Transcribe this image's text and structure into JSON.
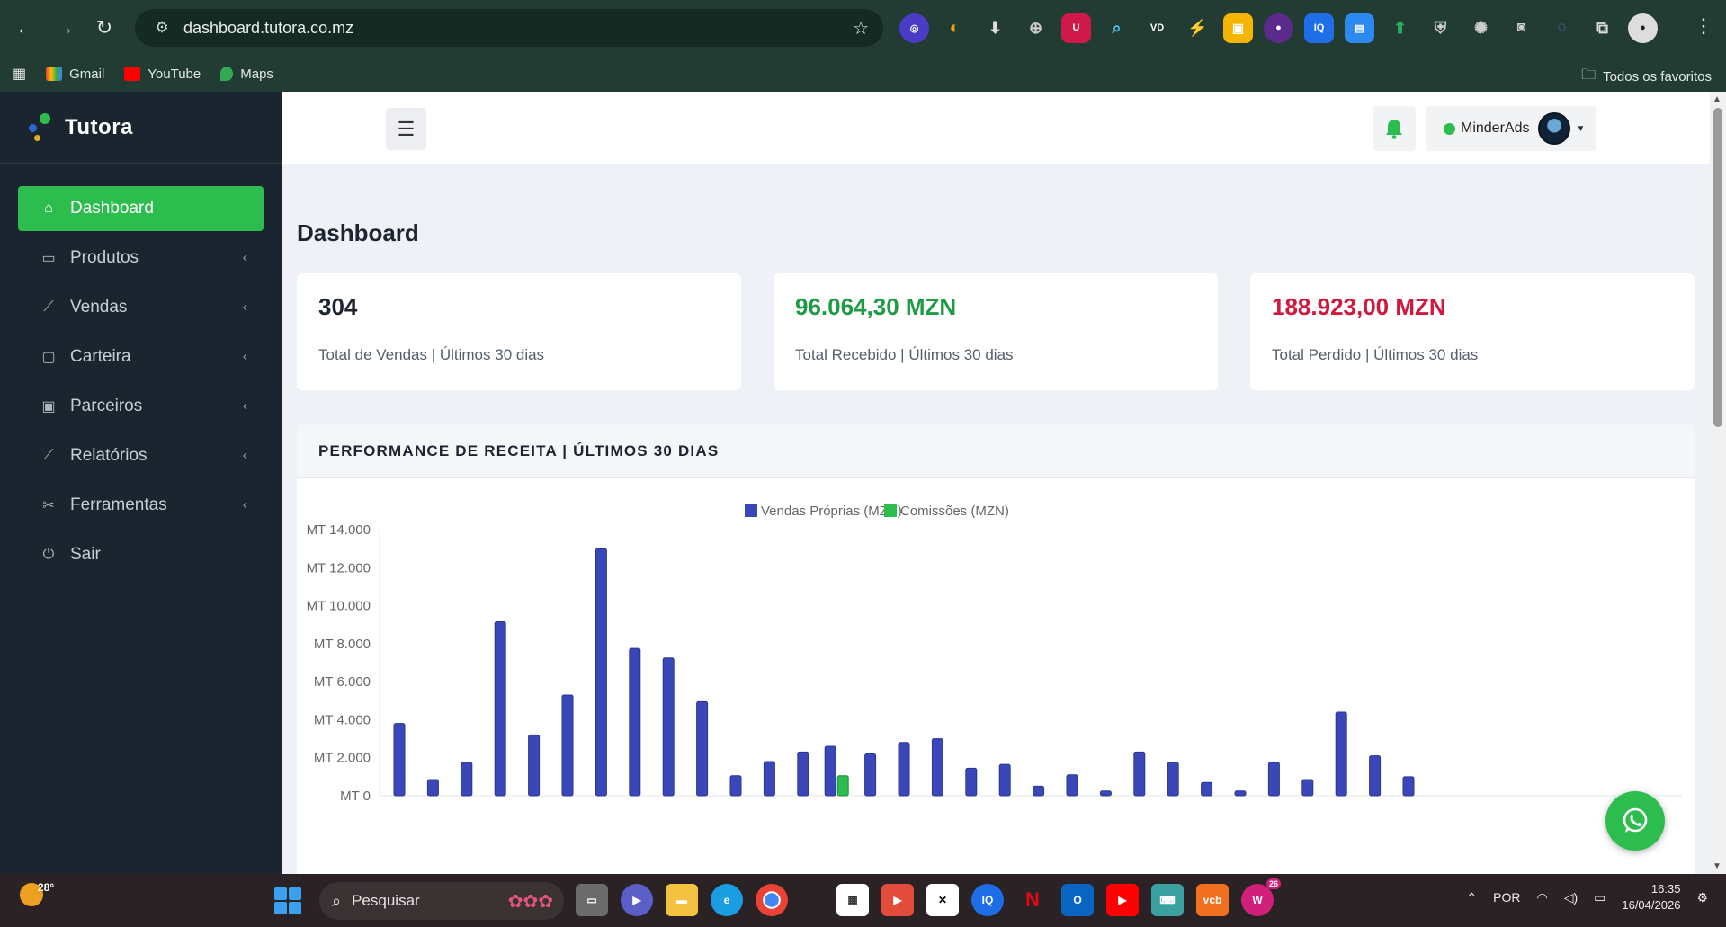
{
  "browser": {
    "url": "dashboard.tutora.co.mz",
    "bookmarks": [
      "Gmail",
      "YouTube",
      "Maps"
    ],
    "all_favorites": "Todos os favoritos",
    "extensions": [
      "ext-1",
      "ext-2",
      "ext-3",
      "ext-4",
      "U",
      "ext-6",
      "VD",
      "ext-8",
      "ext-9",
      "ext-10",
      "IQ",
      "ext-12",
      "ext-13",
      "ext-14",
      "ext-15",
      "ext-16",
      "ext-17",
      "ext-18"
    ]
  },
  "app": {
    "brand": "Tutora",
    "nav": [
      {
        "label": "Dashboard",
        "icon": "home-icon",
        "active": true
      },
      {
        "label": "Produtos",
        "icon": "folder-icon"
      },
      {
        "label": "Vendas",
        "icon": "chart-line-icon"
      },
      {
        "label": "Carteira",
        "icon": "wallet-icon"
      },
      {
        "label": "Parceiros",
        "icon": "user-card-icon"
      },
      {
        "label": "Relatórios",
        "icon": "report-icon"
      },
      {
        "label": "Ferramentas",
        "icon": "tools-icon"
      },
      {
        "label": "Sair",
        "icon": "power-icon"
      }
    ],
    "user": {
      "name": "MinderAds",
      "status": "online"
    },
    "page_title": "Dashboard",
    "cards": [
      {
        "value": "304",
        "label": "Total de Vendas | Últimos 30 dias",
        "color": "#1e2430"
      },
      {
        "value": "96.064,30 MZN",
        "label": "Total Recebido | Últimos 30 dias",
        "color": "#1f9b45"
      },
      {
        "value": "188.923,00 MZN",
        "label": "Total Perdido | Últimos 30 dias",
        "color": "#d0193e"
      }
    ],
    "chart_title": "PERFORMANCE DE RECEITA | ÚLTIMOS 30 DIAS"
  },
  "chart_data": {
    "type": "bar",
    "ytick_labels": [
      "MT 0",
      "MT 2.000",
      "MT 4.000",
      "MT 6.000",
      "MT 8.000",
      "MT 10.000",
      "MT 12.000",
      "MT 14.000"
    ],
    "ylim": [
      0,
      14000
    ],
    "legend_position": "top-center",
    "series": [
      {
        "name": "Vendas Próprias (MZN)",
        "color": "#3a47b8",
        "values": [
          3800,
          850,
          1750,
          9150,
          3200,
          5300,
          13000,
          7750,
          7250,
          4950,
          1050,
          1800,
          2300,
          2600,
          2200,
          2800,
          3000,
          1450,
          1650,
          500,
          1100,
          250,
          2300,
          1750,
          700,
          250,
          1750,
          850,
          4400,
          2100,
          1000
        ]
      },
      {
        "name": "Comissões (MZN)",
        "color": "#2dbd4e",
        "values": [
          0,
          0,
          0,
          0,
          0,
          0,
          0,
          0,
          0,
          0,
          0,
          0,
          0,
          1050,
          0,
          0,
          0,
          0,
          0,
          0,
          0,
          0,
          0,
          0,
          0,
          0,
          0,
          0,
          0,
          0,
          0
        ]
      }
    ]
  },
  "taskbar": {
    "temperature": "28°",
    "search_placeholder": "Pesquisar",
    "language": "POR",
    "time": "16:35",
    "date": "16/04/2026",
    "badge": "26"
  }
}
